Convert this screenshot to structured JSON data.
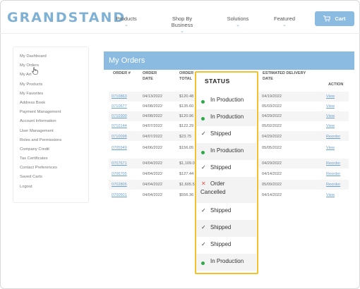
{
  "header": {
    "logo": "GRANDSTAND",
    "nav": [
      "Products",
      "Shop By Business",
      "Solutions",
      "Featured"
    ],
    "cart_label": "Cart"
  },
  "sidebar": {
    "items": [
      "My Dashboard",
      "My Orders",
      "My Art",
      "My Products",
      "My Favorites",
      "Address Book",
      "Payment Management",
      "Account Information",
      "User Management",
      "Roles and Permissions",
      "Company Credit",
      "Tax Certificates",
      "Contact Preferences",
      "Saved Carts",
      "Logout"
    ]
  },
  "orders": {
    "title": "My Orders",
    "headers": {
      "order_num": "ORDER #",
      "order_date": "ORDER DATE",
      "order_total": "ORDER TOTAL",
      "status": "STATUS",
      "delivery": "ESTIMATED DELIVERY DATE",
      "action": "ACTION"
    },
    "rows": [
      {
        "num": "0710863",
        "date": "04/13/2022",
        "total": "$120.48",
        "delivery": "04/19/2022",
        "action": "View"
      },
      {
        "num": "0710677",
        "date": "04/08/2022",
        "total": "$135.60",
        "delivery": "05/03/2022",
        "action": "View"
      },
      {
        "num": "0710300",
        "date": "04/08/2022",
        "total": "$120.96",
        "delivery": "04/29/2022",
        "action": "View"
      },
      {
        "num": "0710144",
        "date": "04/07/2022",
        "total": "$122.29",
        "delivery": "05/02/2022",
        "action": "View"
      },
      {
        "num": "0710098",
        "date": "04/07/2022",
        "total": "$23.75",
        "delivery": "04/29/2022",
        "action": "Reorder"
      },
      {
        "num": "0705949",
        "date": "04/06/2022",
        "total": "$156.05",
        "delivery": "05/05/2022",
        "action": "View"
      },
      {
        "num": "0707671",
        "date": "04/04/2022",
        "total": "$1,109.03",
        "delivery": "04/29/2022",
        "action": "Reorder"
      },
      {
        "num": "0706705",
        "date": "04/04/2022",
        "total": "$127.44",
        "delivery": "04/14/2022",
        "action": "Reorder"
      },
      {
        "num": "0702805",
        "date": "04/04/2022",
        "total": "$1,605.51",
        "delivery": "05/09/2022",
        "action": "Reorder"
      },
      {
        "num": "0700501",
        "date": "04/04/2022",
        "total": "$556.36",
        "delivery": "04/14/2022",
        "action": "View"
      }
    ],
    "statuses": [
      {
        "icon": "dot",
        "text": "In Production"
      },
      {
        "icon": "dot",
        "text": "In Production"
      },
      {
        "icon": "check",
        "text": "Shipped"
      },
      {
        "icon": "dot",
        "text": "In Production"
      },
      {
        "icon": "check",
        "text": "Shipped"
      },
      {
        "icon": "x",
        "text1": "Order",
        "text2": "Cancelled"
      },
      {
        "icon": "check",
        "text": "Shipped"
      },
      {
        "icon": "check",
        "text": "Shipped"
      },
      {
        "icon": "check",
        "text": "Shipped"
      },
      {
        "icon": "dot",
        "text": "In Production"
      }
    ]
  },
  "colors": {
    "brand": "#7fb1d4",
    "header_bar": "#8bbbe0",
    "highlight": "#f2c12e",
    "in_production": "#2ea84a",
    "cancelled": "#d9534f",
    "link": "#6b9fcf"
  },
  "icons": {
    "cart": "cart-icon",
    "in_production": "green-dot-icon",
    "shipped": "check-icon",
    "cancelled": "x-icon"
  }
}
